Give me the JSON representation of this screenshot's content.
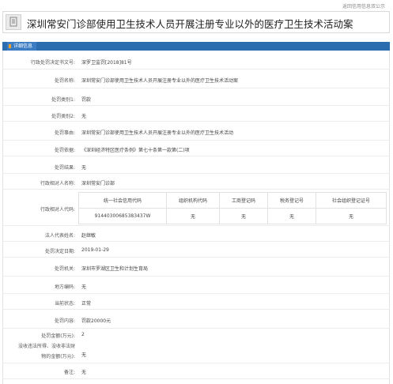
{
  "top_note": "返回信用信息双公示",
  "title": "深圳常安门诊部使用卫生技术人员开展注册专业以外的医疗卫生技术活动案",
  "section_tab": "详细信息",
  "rows": {
    "doc_no": {
      "label": "行政处罚决定书文号:",
      "value": "深罗卫监罚[2018]81号"
    },
    "case_name": {
      "label": "处罚名称:",
      "value": "深圳常安门诊部使用卫生技术人员开展注册专业以外的医疗卫生技术活动案"
    },
    "category1": {
      "label": "处罚类别1:",
      "value": "罚款"
    },
    "category2": {
      "label": "处罚类别2:",
      "value": "无"
    },
    "reason": {
      "label": "处罚事由:",
      "value": "深圳常安门诊部使用卫生技术人员开展注册专业以外的医疗卫生技术活动"
    },
    "basis": {
      "label": "处罚依据:",
      "value": "《深圳经济特区医疗条例》第七十条第一款第(二)项"
    },
    "result": {
      "label": "处罚结果:",
      "value": "无"
    },
    "counterpart": {
      "label": "行政相对人名称:",
      "value": "深圳常安门诊部"
    },
    "legal_rep": {
      "label": "法人代表姓名:",
      "value": "赵继敏"
    },
    "decision_date": {
      "label": "处罚决定日期:",
      "value": "2019-01-29"
    },
    "authority": {
      "label": "处罚机关:",
      "value": "深圳市罗湖区卫生和计划生育局"
    },
    "local_code": {
      "label": "地方编码:",
      "value": "无"
    },
    "status": {
      "label": "当前状态:",
      "value": "正常"
    },
    "content": {
      "label": "处罚内容:",
      "value": "罚款20000元"
    },
    "amount": {
      "label": "处罚金额(万元):",
      "value": "2"
    },
    "confiscated": {
      "label_line1": "没收违法所得、没收非法财",
      "label_line2": "物的金额(万元):",
      "value": "无"
    },
    "remark": {
      "label": "备注:",
      "value": "无"
    }
  },
  "codes": {
    "label": "行政相对人代码:",
    "headers": [
      "统一社会信用代码",
      "组织机构代码",
      "工商登记码",
      "税务登记号",
      "社会组织登记证号"
    ],
    "values": [
      "91440300685383437W",
      "无",
      "无",
      "无",
      "无"
    ]
  }
}
